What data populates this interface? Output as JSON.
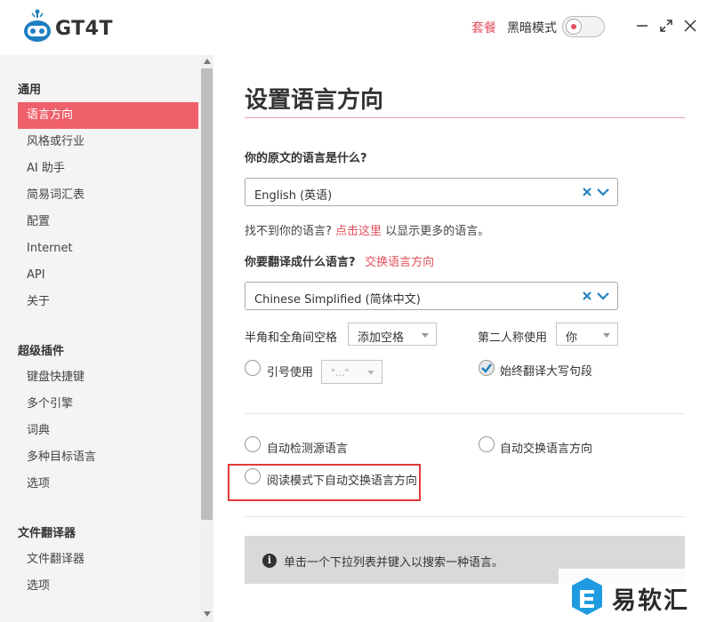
{
  "header": {
    "logo_text": "GT4T",
    "plan_link": "套餐",
    "dark_mode_label": "黑暗模式",
    "dark_mode_on": false
  },
  "sidebar": {
    "groups": [
      {
        "title": "通用",
        "items": [
          "语言方向",
          "风格或行业",
          "AI 助手",
          "简易词汇表",
          "配置",
          "Internet",
          "API",
          "关于"
        ]
      },
      {
        "title": "超级插件",
        "items": [
          "键盘快捷键",
          "多个引擎",
          "词典",
          "多种目标语言",
          "选项"
        ]
      },
      {
        "title": "文件翻译器",
        "items": [
          "文件翻译器",
          "选项"
        ]
      }
    ],
    "active_item": "语言方向"
  },
  "main": {
    "title": "设置语言方向",
    "source_question": "你的原文的语言是什么?",
    "source_value": "English (英语)",
    "help_prefix": "找不到你的语言?",
    "help_link": "点击这里",
    "help_suffix": "以显示更多的语言。",
    "target_question": "你要翻译成什么语言?",
    "swap_link": "交换语言方向",
    "target_value": "Chinese Simplified (简体中文)",
    "spacing_label": "半角和全角间空格",
    "spacing_value": "添加空格",
    "person_label": "第二人称使用",
    "person_value": "你",
    "quote_label": "引号使用",
    "quote_value": "\"...\"",
    "capitalize_label": "始终翻译大写句段",
    "capitalize_checked": true,
    "auto_detect_label": "自动检测源语言",
    "auto_swap_label": "自动交换语言方向",
    "reading_mode_label": "阅读模式下自动交换语言方向",
    "info_text": "单击一个下拉列表并键入以搜索一种语言。"
  },
  "watermark": {
    "text": "易软汇"
  },
  "colors": {
    "accent": "#f0606a",
    "link": "#e2505c",
    "highlight": "#e03a3a"
  }
}
